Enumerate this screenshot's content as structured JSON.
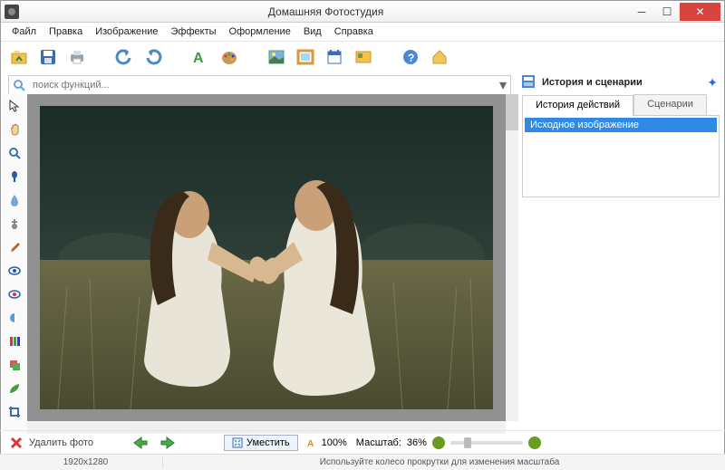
{
  "window": {
    "title": "Домашняя Фотостудия"
  },
  "menu": {
    "file": "Файл",
    "edit": "Правка",
    "image": "Изображение",
    "effects": "Эффекты",
    "design": "Оформление",
    "view": "Вид",
    "help": "Справка"
  },
  "search": {
    "placeholder": "поиск функций..."
  },
  "rightpanel": {
    "title": "История и сценарии",
    "tab_history": "История действий",
    "tab_scenarios": "Сценарии",
    "history_item": "Исходное изображение"
  },
  "bottom": {
    "delete": "Удалить фото",
    "fit": "Уместить",
    "hundred": "100%",
    "scale_label": "Масштаб:",
    "scale_value": "36%"
  },
  "status": {
    "dimensions": "1920x1280",
    "hint": "Используйте колесо прокрутки для изменения масштаба"
  }
}
